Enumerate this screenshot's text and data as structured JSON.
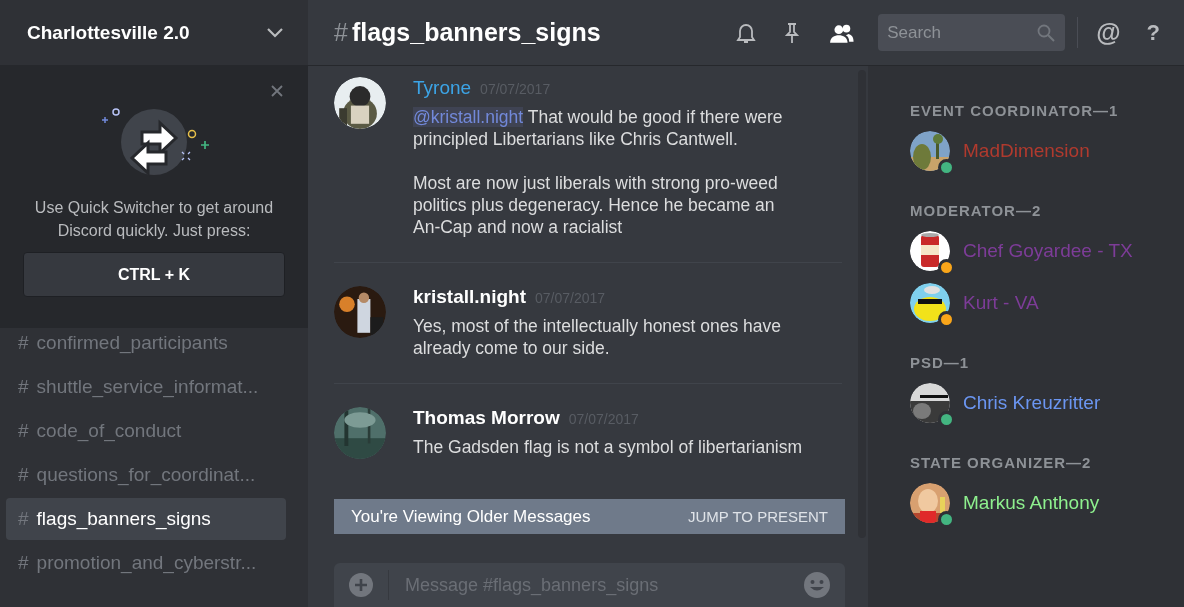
{
  "server": {
    "name": "Charlottesville 2.0"
  },
  "quick_switcher": {
    "message": "Use Quick Switcher to get around Discord quickly. Just press:",
    "shortcut": "CTRL + K"
  },
  "channels": [
    {
      "hash": "#",
      "name": "confirmed_participants",
      "selected": false
    },
    {
      "hash": "#",
      "name": "shuttle_service_informat...",
      "selected": false
    },
    {
      "hash": "#",
      "name": "code_of_conduct",
      "selected": false
    },
    {
      "hash": "#",
      "name": "questions_for_coordinat...",
      "selected": false
    },
    {
      "hash": "#",
      "name": "flags_banners_signs",
      "selected": true
    },
    {
      "hash": "#",
      "name": "promotion_and_cyberstr...",
      "selected": false
    }
  ],
  "header": {
    "hash": "#",
    "channel": "flags_banners_signs",
    "search_placeholder": "Search",
    "at": "@",
    "help": "?"
  },
  "messages": [
    {
      "author": "Tyrone",
      "color": "#3ca4e6",
      "time": "07/07/2017",
      "mention": "@kristall.night",
      "paragraphs": [
        "That would be good if there were principled Libertarians like Chris Cantwell.",
        "Most are now just liberals with strong pro-weed politics plus degeneracy. Hence he became an An-Cap and now a racialist"
      ]
    },
    {
      "author": "kristall.night",
      "color": "#ffffff",
      "time": "07/07/2017",
      "paragraphs": [
        "Yes, most of the intellectually honest ones have already come to our side."
      ]
    },
    {
      "author": "Thomas Morrow",
      "color": "#ffffff",
      "time": "07/07/2017",
      "paragraphs": [
        "The Gadsden flag is not a symbol of libertarianism"
      ]
    }
  ],
  "older_bar": {
    "text": "You're Viewing Older Messages",
    "action": "JUMP TO PRESENT"
  },
  "composer": {
    "placeholder": "Message #flags_banners_signs"
  },
  "member_groups": [
    {
      "title": "EVENT COORDINATOR—1",
      "members": [
        {
          "name": "MadDimension",
          "color": "#b03a2e",
          "status": {
            "color": "#43b581"
          }
        }
      ]
    },
    {
      "title": "MODERATOR—2",
      "members": [
        {
          "name": "Chef Goyardee - TX",
          "color": "#7d3c98",
          "status": {
            "color": "#faa61a"
          }
        },
        {
          "name": "Kurt - VA",
          "color": "#7d3c98",
          "status": {
            "color": "#faa61a"
          }
        }
      ]
    },
    {
      "title": "PSD—1",
      "members": [
        {
          "name": "Chris Kreuzritter",
          "color": "#6b96f2",
          "status": {
            "color": "#43b581"
          }
        }
      ]
    },
    {
      "title": "STATE ORGANIZER—2",
      "members": [
        {
          "name": "Markus Anthony",
          "color": "#8ef08e",
          "status": {
            "color": "#43b581"
          }
        }
      ]
    }
  ]
}
